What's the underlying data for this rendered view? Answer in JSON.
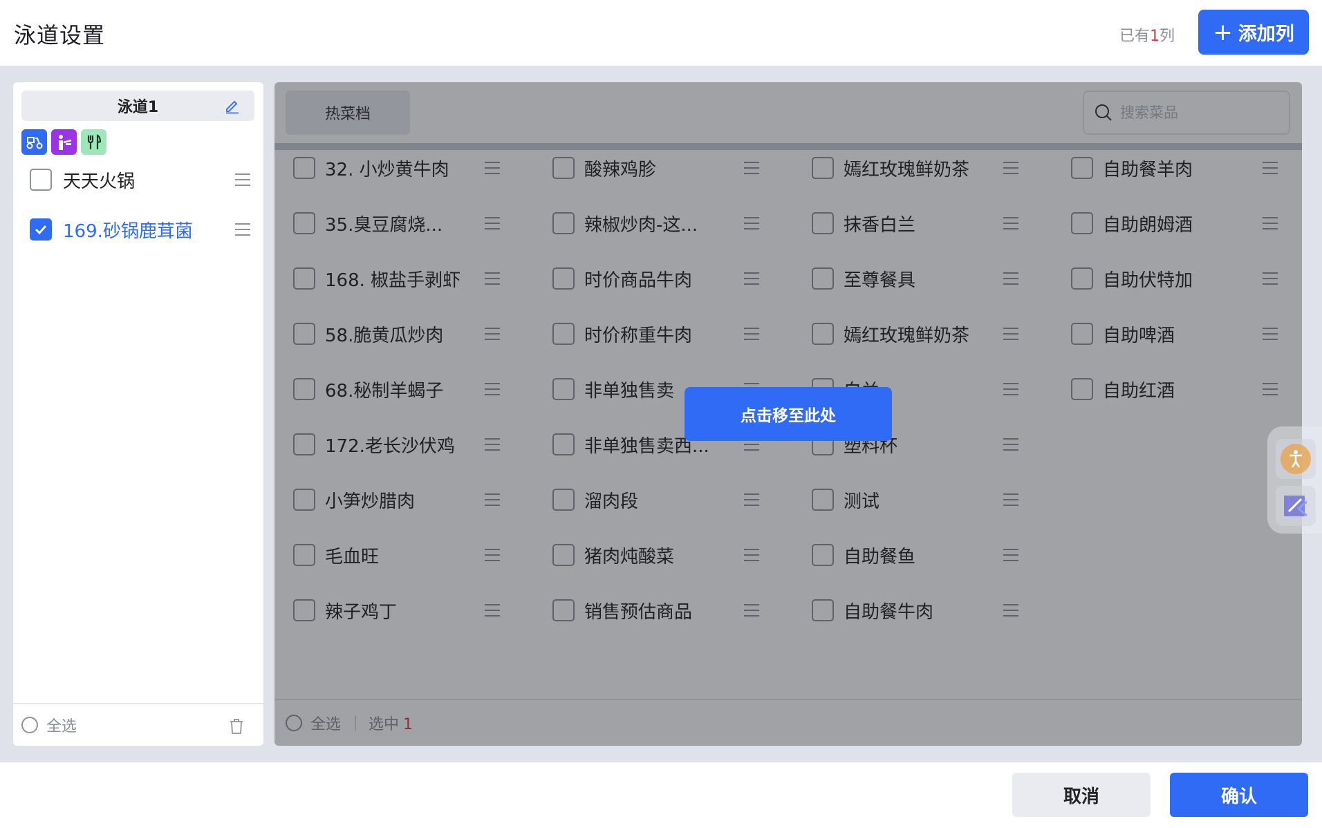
{
  "header": {
    "title": "泳道设置",
    "count_prefix": "已有",
    "count_value": "1",
    "count_suffix": "列",
    "add_column_label": "添加列"
  },
  "lane": {
    "name": "泳道1",
    "channel_icons": [
      "delivery-scooter-icon",
      "waiter-icon",
      "dine-in-fork-knife-icon"
    ],
    "items": [
      {
        "label": "天天火锅",
        "checked": false
      },
      {
        "label": "169.砂锅鹿茸菌",
        "checked": true
      }
    ],
    "footer": {
      "select_all_label": "全选"
    }
  },
  "dishes_panel": {
    "tab_label": "热菜档",
    "search_placeholder": "搜索菜品",
    "columns": [
      [
        "32. 小炒黄牛肉",
        "35.臭豆腐烧...",
        "168. 椒盐手剥虾",
        "58.脆黄瓜炒肉",
        "68.秘制羊蝎子",
        "172.老长沙伏鸡",
        "小笋炒腊肉",
        "毛血旺",
        "辣子鸡丁"
      ],
      [
        "酸辣鸡胗",
        "辣椒炒肉-这...",
        "时价商品牛肉",
        "时价称重牛肉",
        "非单独售卖",
        "非单独售卖西...",
        "溜肉段",
        "猪肉炖酸菜",
        "销售预估商品"
      ],
      [
        "嫣红玫瑰鲜奶茶",
        "抹香白兰",
        "至尊餐具",
        "嫣红玫瑰鲜奶茶",
        "白兰",
        "塑料杯",
        "测试",
        "自助餐鱼",
        "自助餐牛肉"
      ],
      [
        "自助餐羊肉",
        "自助朗姆酒",
        "自助伏特加",
        "自助啤酒",
        "自助红酒"
      ]
    ],
    "footer": {
      "select_all_label": "全选",
      "selected_label": "选中",
      "selected_count": "1"
    }
  },
  "overlay": {
    "move_here_label": "点击移至此处"
  },
  "bottom": {
    "cancel_label": "取消",
    "confirm_label": "确认"
  },
  "side_widget": {
    "icons": [
      "accessibility-icon",
      "feedback-icon"
    ]
  },
  "colors": {
    "primary": "#2f6bf4",
    "count_red": "#e0393e",
    "purple_badge": "#9a35e6",
    "green_badge": "#9fe6bb"
  }
}
